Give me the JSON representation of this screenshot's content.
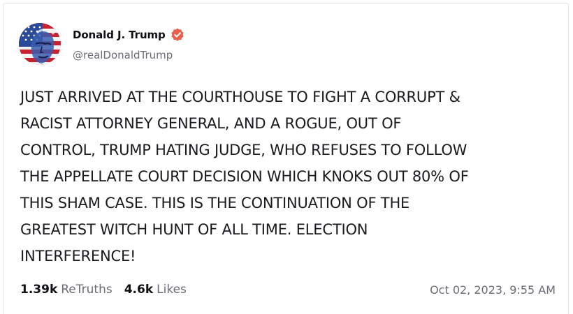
{
  "post": {
    "author": {
      "display_name": "Donald J. Trump",
      "handle": "@realDonaldTrump",
      "verified": true,
      "avatar_icon": "avatar-flag-portrait-icon",
      "verified_icon": "verified-badge-icon"
    },
    "text": "JUST ARRIVED AT THE COURTHOUSE TO FIGHT A CORRUPT &\nRACIST  ATTORNEY GENERAL, AND A ROGUE, OUT OF\nCONTROL, TRUMP HATING JUDGE, WHO REFUSES TO FOLLOW\nTHE APPELLATE COURT DECISION WHICH KNOKS OUT 80% OF\nTHIS SHAM CASE. THIS IS THE CONTINUATION OF THE\nGREATEST WITCH HUNT OF ALL TIME. ELECTION\nINTERFERENCE!",
    "stats": {
      "retruths_count": "1.39k",
      "retruths_label": "ReTruths",
      "likes_count": "4.6k",
      "likes_label": "Likes"
    },
    "timestamp": "Oct 02, 2023, 9:55 AM"
  },
  "colors": {
    "verified_badge": "#e8604c",
    "muted_text": "#6b6b76",
    "border": "#e4e4e7"
  }
}
